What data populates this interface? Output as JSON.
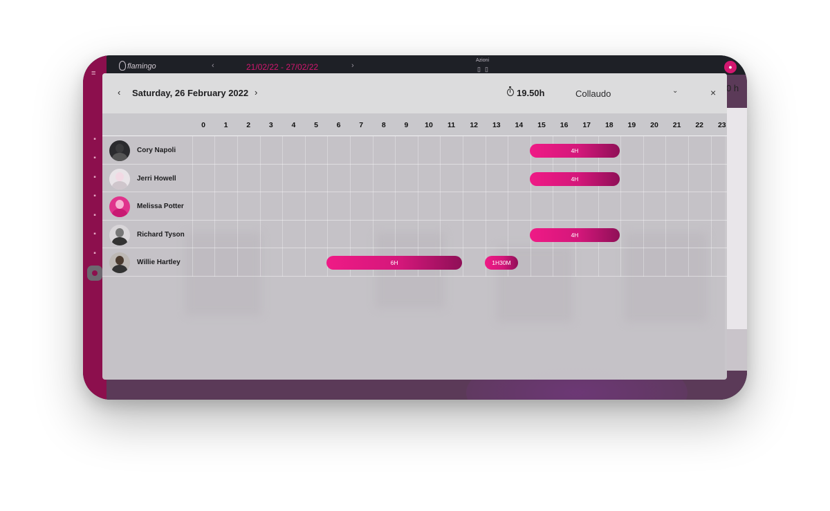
{
  "app": {
    "logo_text": "flamingo",
    "week_range": "21/02/22 - 27/02/22",
    "week_prev": "‹",
    "week_next": "›",
    "actions_label": "Azioni",
    "hours_peek": "0 h",
    "bell_icon": "bell-icon"
  },
  "modal": {
    "date_title": "Saturday, 26 February 2022",
    "prev_icon": "‹",
    "next_icon": "›",
    "total_hours": "19.50h",
    "project": "Collaudo",
    "chevron": "⌄",
    "close_icon": "×"
  },
  "hours": [
    "0",
    "1",
    "2",
    "3",
    "4",
    "5",
    "6",
    "7",
    "8",
    "9",
    "10",
    "11",
    "12",
    "13",
    "14",
    "15",
    "16",
    "17",
    "18",
    "19",
    "20",
    "21",
    "22",
    "23"
  ],
  "people": [
    {
      "name": "Cory Napoli",
      "bars": [
        {
          "start": 14.5,
          "end": 18.5,
          "label": "4H"
        }
      ]
    },
    {
      "name": "Jerri Howell",
      "bars": [
        {
          "start": 14.5,
          "end": 18.5,
          "label": "4H"
        }
      ]
    },
    {
      "name": "Melissa Potter",
      "bars": []
    },
    {
      "name": "Richard Tyson",
      "bars": [
        {
          "start": 14.5,
          "end": 18.5,
          "label": "4H"
        }
      ]
    },
    {
      "name": "Willie Hartley",
      "bars": [
        {
          "start": 5.5,
          "end": 11.5,
          "label": "6H"
        },
        {
          "start": 12.5,
          "end": 14,
          "label": "1H30M"
        }
      ]
    }
  ],
  "colors": {
    "accent": "#d3176f",
    "sidebar": "#8c0f4d",
    "bar_start": "#ef1a86",
    "bar_end": "#8f0f57"
  }
}
